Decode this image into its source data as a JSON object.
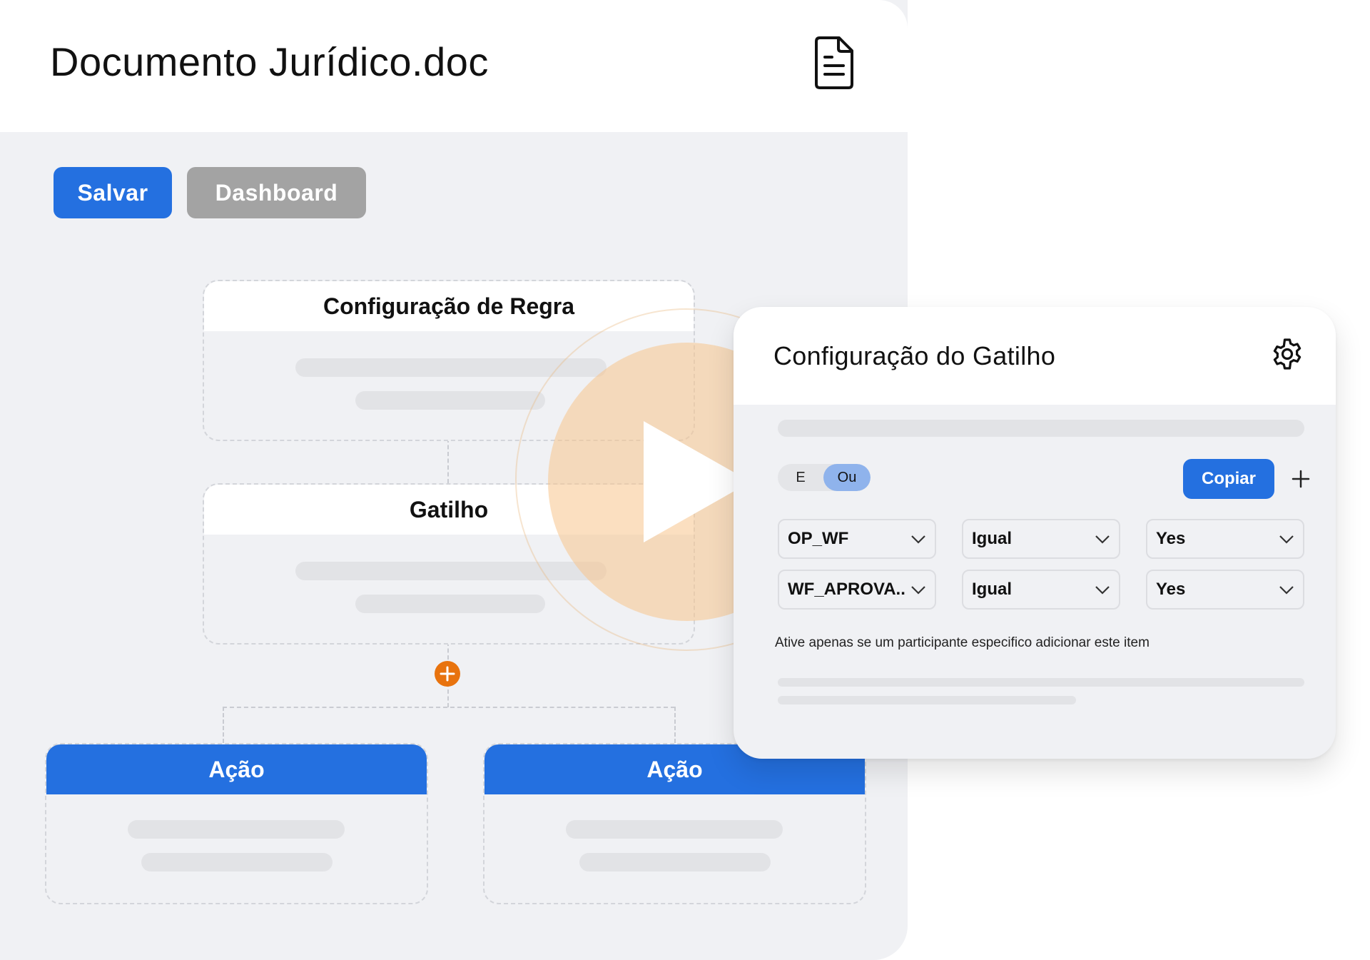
{
  "document": {
    "title": "Documento Jurídico.doc",
    "icon": "document-icon"
  },
  "toolbar": {
    "save_label": "Salvar",
    "dashboard_label": "Dashboard"
  },
  "flow": {
    "rule_title": "Configuração de Regra",
    "trigger_title": "Gatilho",
    "actions": [
      {
        "title": "Ação"
      },
      {
        "title": "Ação"
      }
    ],
    "add_icon": "plus-icon",
    "play_icon": "play-icon"
  },
  "trigger_panel": {
    "title": "Configuração do Gatilho",
    "settings_icon": "gear-icon",
    "logic_toggle": {
      "options": [
        "E",
        "Ou"
      ],
      "selected": "Ou"
    },
    "copy_label": "Copiar",
    "add_icon": "plus-icon",
    "conditions": [
      {
        "field": "OP_WF",
        "operator": "Igual",
        "value": "Yes"
      },
      {
        "field": "WF_APROVA..",
        "operator": "Igual",
        "value": "Yes"
      }
    ],
    "note": "Ative apenas se um participante especifico adicionar este item"
  },
  "colors": {
    "accent": "#2470e0",
    "secondary_button": "#a3a3a3",
    "add_node": "#e8730e",
    "play_overlay": "#f8c48c",
    "canvas": "#f0f1f4"
  }
}
